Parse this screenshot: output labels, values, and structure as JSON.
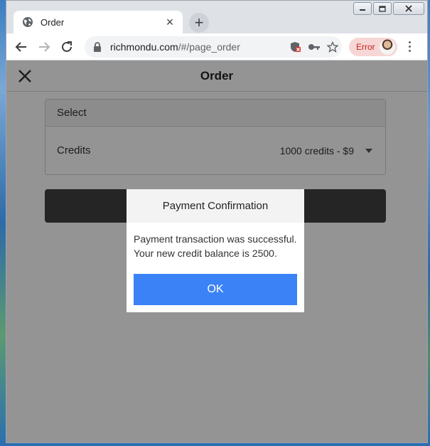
{
  "browser": {
    "tab": {
      "title": "Order",
      "favicon": "globe-icon"
    },
    "new_tab_icon": "plus-icon",
    "url_host": "richmondu.com",
    "url_path": "/#/page_order",
    "profile_status": "Error",
    "window_controls": [
      "minimize",
      "maximize",
      "close"
    ]
  },
  "page": {
    "title": "Order",
    "close_icon": "close-icon",
    "select": {
      "header": "Select",
      "label": "Credits",
      "value": "1000 credits - $9"
    }
  },
  "dialog": {
    "title": "Payment Confirmation",
    "message_line1": "Payment transaction was successful.",
    "message_line2": "Your new credit balance is 2500.",
    "ok_label": "OK"
  },
  "colors": {
    "ok_button": "#3b82f6",
    "overlay": "rgba(0,0,0,0.42)",
    "error_chip": "#f6d7d5"
  }
}
